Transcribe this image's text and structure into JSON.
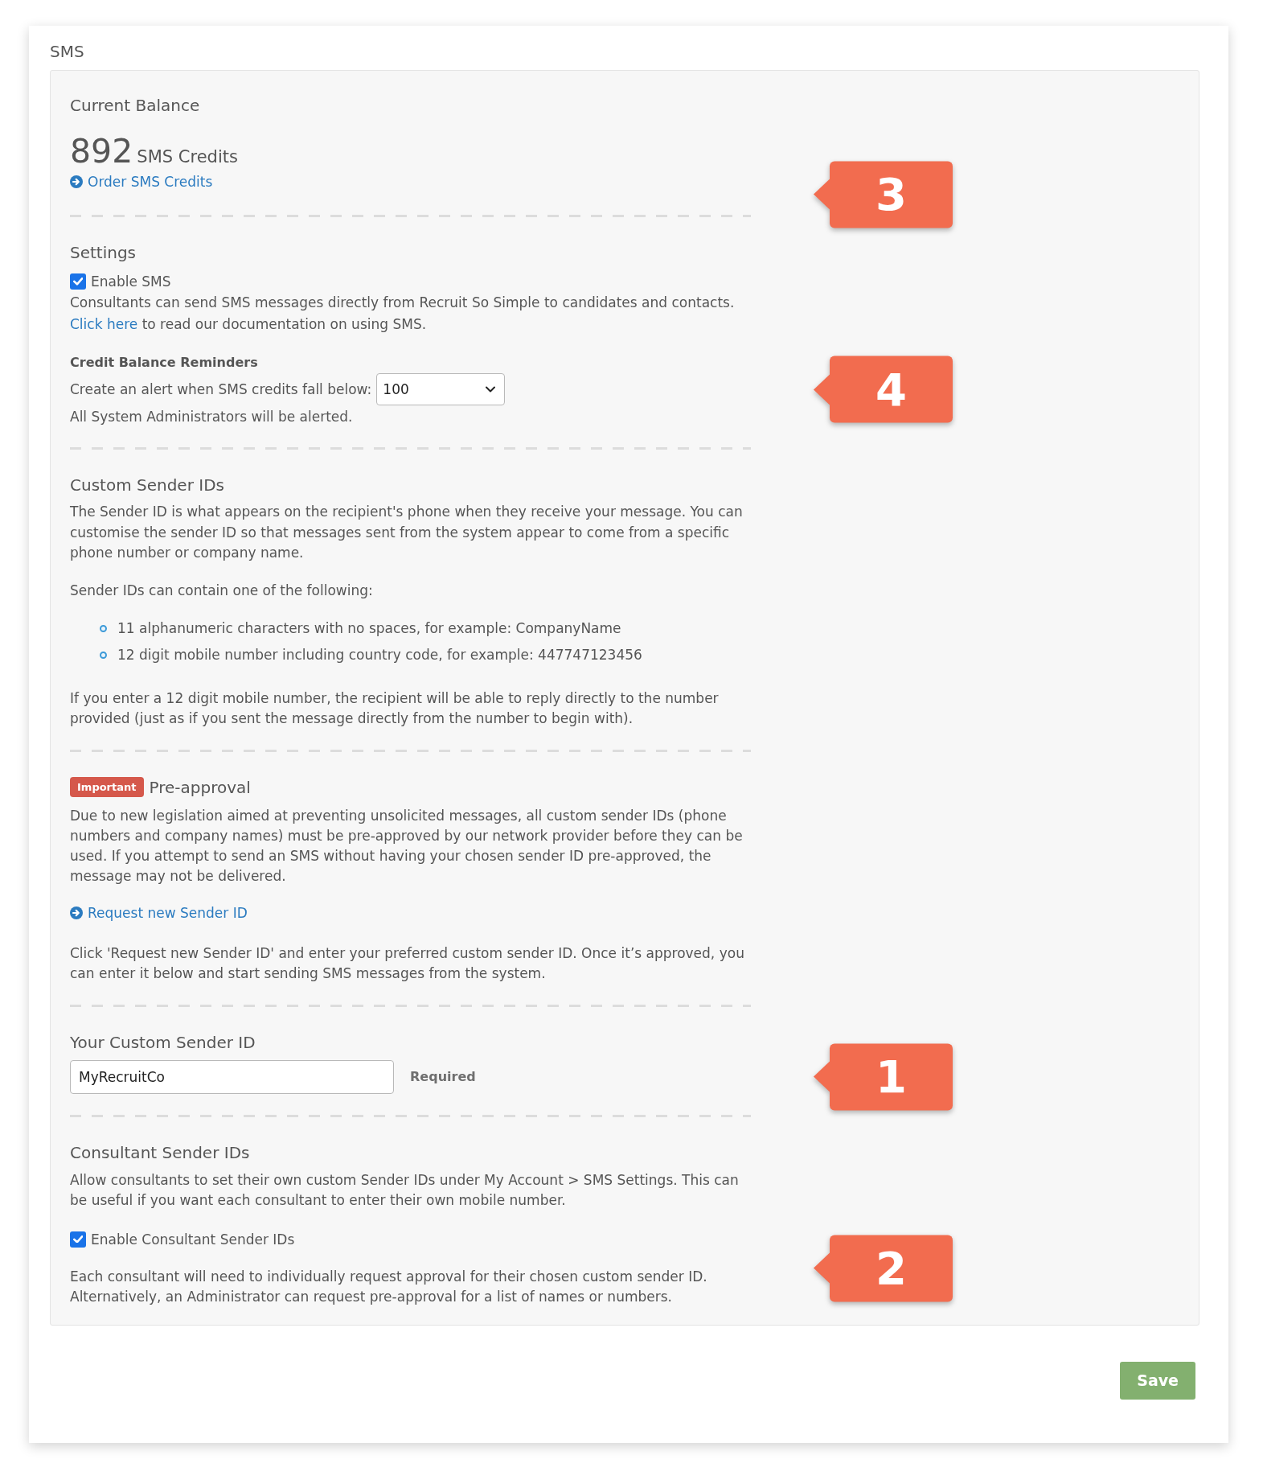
{
  "card": {
    "title": "SMS"
  },
  "balance": {
    "heading": "Current Balance",
    "amount": "892",
    "unit": "SMS Credits",
    "link": "Order SMS Credits",
    "callout": "3"
  },
  "settings": {
    "heading": "Settings",
    "checkbox": {
      "label": "Enable SMS",
      "checked": true
    },
    "description": "Consultants can send SMS messages directly from Recruit So Simple to candidates and contacts.",
    "doc_link": "Click here",
    "doc_text": "to read our documentation on using SMS."
  },
  "reminders": {
    "heading": "Credit Balance Reminders",
    "label": "Create an alert when SMS credits fall below:",
    "select": {
      "value": "100"
    },
    "note": "All System Administrators will be alerted.",
    "callout": "4"
  },
  "custom_sender_ids": {
    "heading": "Custom Sender IDs",
    "intro": "The Sender ID is what appears on the recipient's phone when they receive your message. You can customise the sender ID so that messages sent from the system appear to come from a specific phone number or company name.",
    "list_intro": "Sender IDs can contain one of the following:",
    "items": [
      "11 alphanumeric characters with no spaces, for example: CompanyName",
      "12 digit mobile number including country code, for example: 447747123456"
    ],
    "note": "If you enter a 12 digit mobile number, the recipient will be able to reply directly to the number provided (just as if you sent the message directly from the number to begin with)."
  },
  "pre_approval": {
    "badge": "Important",
    "heading": "Pre-approval",
    "text": "Due to new legislation aimed at preventing unsolicited messages, all custom sender IDs (phone numbers and company names) must be pre-approved by our network provider before they can be used. If you attempt to send an SMS without having your chosen sender ID pre-approved, the message may not be delivered.",
    "link": "Request new Sender ID",
    "instructions": "Click 'Request new Sender ID' and enter your preferred custom sender ID. Once it’s approved, you can enter it below and start sending SMS messages from the system."
  },
  "sender_id_field": {
    "label": "Your Custom Sender ID",
    "value": "MyRecruitCo",
    "required": "Required",
    "callout": "1"
  },
  "consultant_sender_ids": {
    "heading": "Consultant Sender IDs",
    "text": "Allow consultants to set their own custom Sender IDs under My Account > SMS Settings. This can be useful if you want each consultant to enter their own mobile number.",
    "checkbox": {
      "label": "Enable Consultant Sender IDs",
      "checked": true
    },
    "note": "Each consultant will need to individually request approval for their chosen custom sender ID. Alternatively, an Administrator can request pre-approval for a list of names or numbers.",
    "callout": "2"
  },
  "save_button": {
    "label": "Save"
  }
}
